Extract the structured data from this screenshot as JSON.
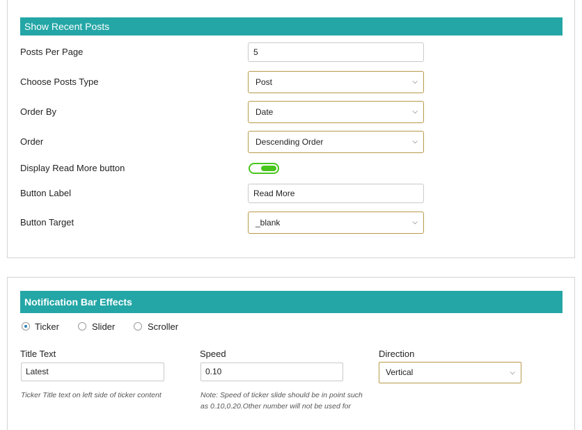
{
  "recent_posts": {
    "header": "Show Recent Posts",
    "posts_per_page": {
      "label": "Posts Per Page",
      "value": "5"
    },
    "posts_type": {
      "label": "Choose Posts Type",
      "value": "Post"
    },
    "order_by": {
      "label": "Order By",
      "value": "Date"
    },
    "order": {
      "label": "Order",
      "value": "Descending Order"
    },
    "read_more": {
      "label": "Display Read More button",
      "enabled": true
    },
    "button_label": {
      "label": "Button Label",
      "value": "Read More"
    },
    "button_target": {
      "label": "Button Target",
      "value": "_blank"
    }
  },
  "effects": {
    "header": "Notification Bar Effects",
    "options": [
      "Ticker",
      "Slider",
      "Scroller"
    ],
    "selected": "Ticker",
    "title_text": {
      "label": "Title Text",
      "value": "Latest",
      "note": "Ticker Title text on left side of ticker content"
    },
    "speed": {
      "label": "Speed",
      "value": "0.10",
      "note_line1": "Note: Speed of ticker slide should be in point such",
      "note_line2": "as 0.10,0.20.Other number will not be used for"
    },
    "direction": {
      "label": "Direction",
      "value": "Vertical"
    }
  },
  "icons": {
    "chevron": "chevron-down-icon"
  },
  "colors": {
    "header": "#24a6a6",
    "toggle": "#48c61c",
    "select_border": "#b8994a"
  }
}
